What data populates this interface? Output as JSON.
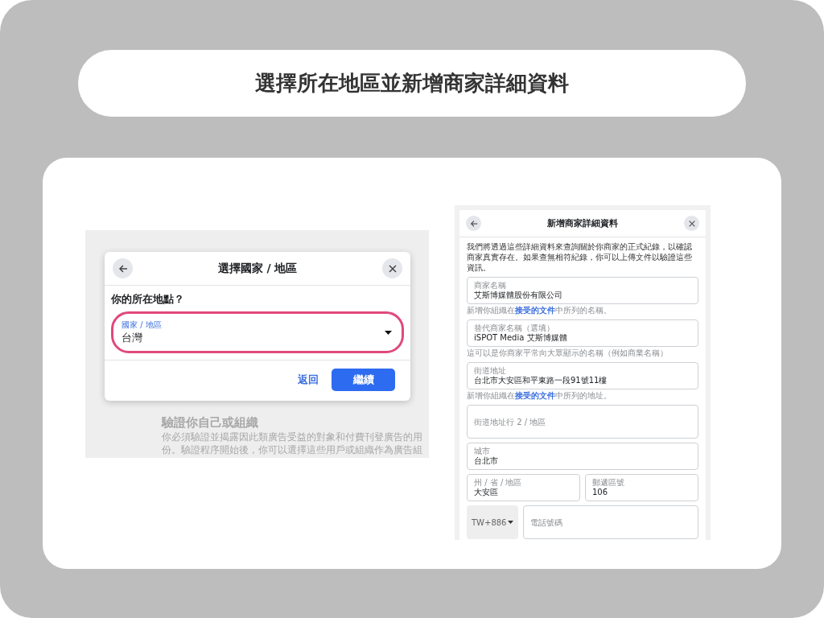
{
  "heading": "選擇所在地區並新增商家詳細資料",
  "left_screen": {
    "background_title": "驗證你自己或組織",
    "background_lines": [
      "你必須驗證並揭露因此類廣告受益的對象和付費刊登廣告的用",
      "份。驗證程序開始後，你可以選擇這些用戶或組織作為廣告組"
    ],
    "dialog": {
      "title": "選擇國家 / 地區",
      "question": "你的所在地點？",
      "select": {
        "label": "國家 / 地區",
        "value": "台灣",
        "highlighted": true
      },
      "buttons": [
        {
          "label": "返回",
          "kind": "link"
        },
        {
          "label": "繼續",
          "kind": "primary"
        }
      ]
    }
  },
  "right_screen": {
    "title": "新增商家詳細資料",
    "description": "我們將透過這些詳細資料來查詢關於你商家的正式紀錄，以確認商家真實存在。如果查無相符紀錄，你可以上傳文件以驗證這些資訊。",
    "rows": [
      {
        "fields": [
          {
            "label": "商家名稱",
            "value": "艾斯博媒體股份有限公司"
          }
        ],
        "help": {
          "before": "新增你組織在",
          "link": "接受的文件",
          "after": "中所列的名稱。"
        }
      },
      {
        "fields": [
          {
            "label": "替代商家名稱（選填）",
            "value": "iSPOT Media 艾斯博媒體"
          }
        ],
        "help": {
          "before": "這可以是你商家平常向大眾顯示的名稱（例如商業名稱）"
        }
      },
      {
        "fields": [
          {
            "label": "街道地址",
            "value": "台北市大安區和平東路一段91號11樓"
          }
        ],
        "help": {
          "before": "新增你組織在",
          "link": "接受的文件",
          "after": "中所列的地址。"
        }
      },
      {
        "fields": [
          {
            "placeholder": "街道地址行 2 / 地區"
          }
        ]
      },
      {
        "fields": [
          {
            "label": "城市",
            "value": "台北市"
          }
        ]
      },
      {
        "fields": [
          {
            "label": "州 / 省 / 地區",
            "value": "大安區"
          },
          {
            "label": "郵遞區號",
            "value": "106"
          }
        ]
      },
      {
        "fields": [
          {
            "kind": "country_code",
            "value": "TW+886"
          },
          {
            "placeholder": "電話號碼"
          }
        ]
      }
    ]
  }
}
